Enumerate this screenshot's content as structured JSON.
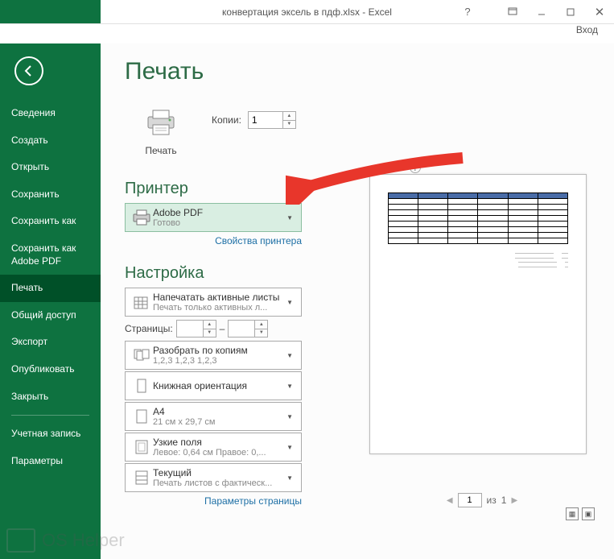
{
  "window": {
    "title": "конвертация эксель в пдф.xlsx - Excel",
    "login": "Вход"
  },
  "sidebar": {
    "items": [
      "Сведения",
      "Создать",
      "Открыть",
      "Сохранить",
      "Сохранить как",
      "Сохранить как Adobe PDF",
      "Печать",
      "Общий доступ",
      "Экспорт",
      "Опубликовать",
      "Закрыть",
      "Учетная запись",
      "Параметры"
    ],
    "active_index": 6
  },
  "page": {
    "title": "Печать",
    "print_button": "Печать",
    "copies_label": "Копии:",
    "copies_value": "1"
  },
  "printer": {
    "section": "Принтер",
    "name": "Adobe PDF",
    "status": "Готово",
    "properties_link": "Свойства принтера"
  },
  "settings": {
    "section": "Настройка",
    "items": [
      {
        "line1": "Напечатать активные листы",
        "line2": "Печать только активных л...",
        "icon": "sheets"
      },
      {
        "line1": "Разобрать по копиям",
        "line2": "1,2,3   1,2,3   1,2,3",
        "icon": "collate"
      },
      {
        "line1": "Книжная ориентация",
        "line2": "",
        "icon": "portrait"
      },
      {
        "line1": "A4",
        "line2": "21 см x 29,7 см",
        "icon": "page"
      },
      {
        "line1": "Узкие поля",
        "line2": "Левое: 0,64 см  Правое: 0,...",
        "icon": "margins"
      },
      {
        "line1": "Текущий",
        "line2": "Печать листов с фактическ...",
        "icon": "scale"
      }
    ],
    "pages_label": "Страницы:",
    "pages_from": "",
    "pages_to": "",
    "pages_dash": "–",
    "page_setup_link": "Параметры страницы"
  },
  "preview": {
    "page_current": "1",
    "page_label_of": "из",
    "page_total": "1"
  },
  "watermark": "OS Helper"
}
